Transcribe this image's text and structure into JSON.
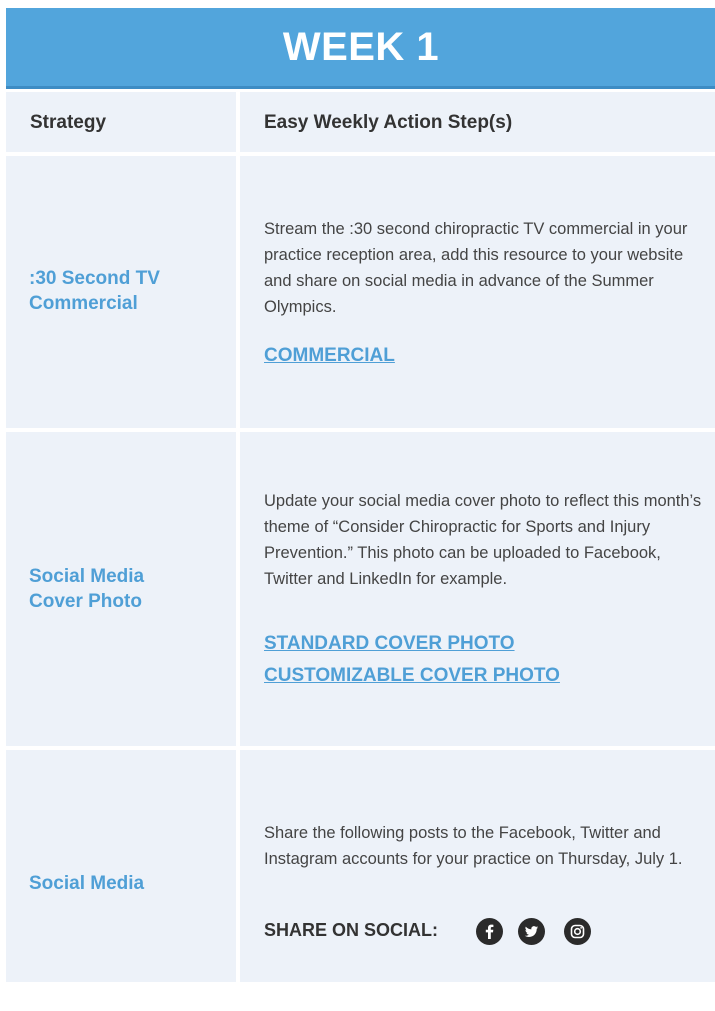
{
  "header": {
    "title": "WEEK 1"
  },
  "table": {
    "columns": [
      "Strategy",
      "Easy Weekly Action Step(s)"
    ],
    "rows": [
      {
        "strategy": ":30 Second TV Commercial",
        "description": "Stream the :30 second chiropractic TV commercial in your practice reception area, add this resource to your website and share on social media in advance of the Summer Olympics.",
        "links": [
          "COMMERCIAL"
        ]
      },
      {
        "strategy": "Social Media Cover Photo",
        "description": "Update your social media cover photo to reflect this month’s theme of “Consider Chiropractic for Sports and Injury Prevention.” This photo can be uploaded to Facebook, Twitter and LinkedIn for example.",
        "links": [
          "STANDARD COVER PHOTO",
          "CUSTOMIZABLE COVER PHOTO"
        ]
      },
      {
        "strategy": "Social Media",
        "description": "Share the following posts to the Facebook, Twitter and Instagram accounts for your practice on Thursday, July 1.",
        "share_label": "SHARE ON SOCIAL:",
        "icons": [
          "facebook-icon",
          "twitter-icon",
          "instagram-icon"
        ]
      }
    ]
  },
  "colors": {
    "header_bg": "#52a5dc",
    "cell_bg": "#edf2f9",
    "accent": "#4f9fd6",
    "icon": "#2b2b2b"
  }
}
